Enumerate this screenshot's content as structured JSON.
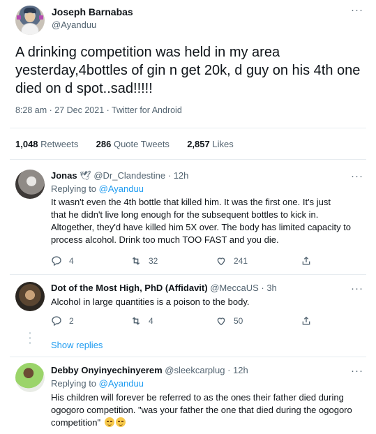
{
  "tweet": {
    "author_name": "Joseph Barnabas",
    "author_handle": "@Ayanduu",
    "more_label": "···",
    "text": "A drinking competition was held in my area yesterday,4bottles of gin n get 20k, d guy on his 4th one died on d spot..sad!!!!!",
    "meta": "8:28 am · 27 Dec 2021 · Twitter for Android",
    "stats": {
      "retweets_count": "1,048",
      "retweets_label": "Retweets",
      "quotes_count": "286",
      "quotes_label": "Quote Tweets",
      "likes_count": "2,857",
      "likes_label": "Likes"
    }
  },
  "replies": [
    {
      "name": "Jonas",
      "badge": "🕊",
      "handle_time": "@Dr_Clandestine · 12h",
      "replying_prefix": "Replying to",
      "replying_handle": "@Ayanduu",
      "text_lines": [
        "It wasn't even the 4th bottle that killed him. It was the first one. It's just",
        "that he didn't live long enough for the subsequent bottles to kick in.",
        "Altogether, they'd have killed him 5X over. The body has limited capacity to",
        "process alcohol. Drink too much TOO FAST and you die."
      ],
      "replies": "4",
      "retweets": "32",
      "likes": "241"
    },
    {
      "name": "Dot of the Most High, PhD (Affidavit)",
      "handle_time": "@MeccaUS · 3h",
      "text_lines": [
        "Alcohol in large quantities is a poison to the body."
      ],
      "replies": "2",
      "retweets": "4",
      "likes": "50",
      "show_replies": "Show replies"
    },
    {
      "name": "Debby Onyinyechinyerem",
      "handle_time": "@sleekcarplug · 12h",
      "replying_prefix": "Replying to",
      "replying_handle": "@Ayanduu",
      "text_lines": [
        "His children will forever be referred to as the ones their father died during",
        "ogogoro competition. \"was your father the one that died during the ogogoro",
        "competition\""
      ],
      "emojis": [
        "pensive-face",
        "pensive-face"
      ]
    }
  ],
  "icons": {
    "reply": "reply-icon",
    "retweet": "retweet-icon",
    "like": "heart-icon",
    "share": "share-icon",
    "more": "more-icon"
  },
  "colors": {
    "link": "#1d9bf0",
    "muted": "#536471",
    "text": "#0f1419"
  }
}
